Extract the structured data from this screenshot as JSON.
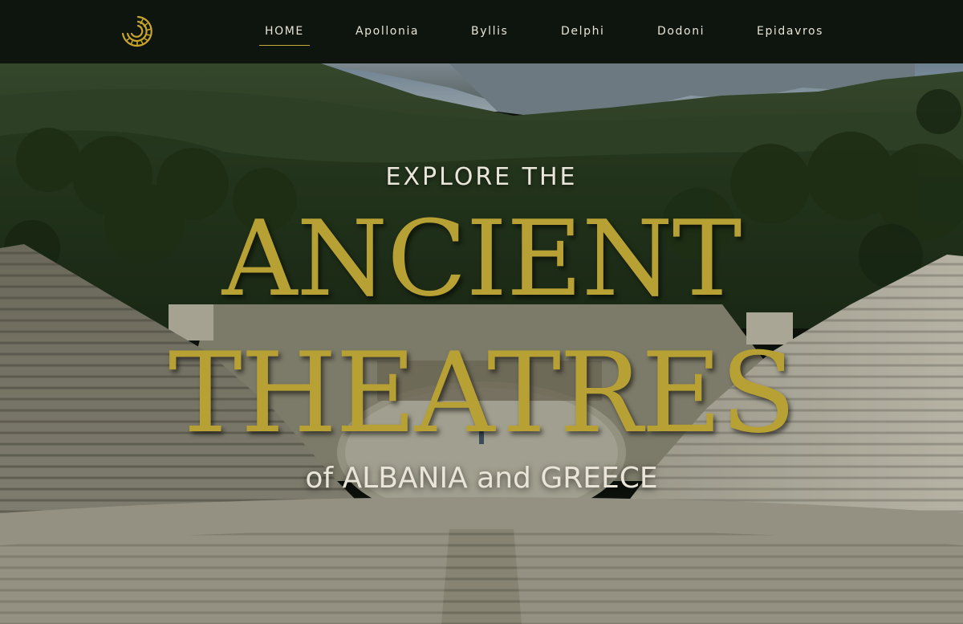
{
  "nav": {
    "logo_icon": "theatre-logo-icon",
    "items": [
      {
        "label": "HOME",
        "active": true
      },
      {
        "label": "Apollonia",
        "active": false
      },
      {
        "label": "Byllis",
        "active": false
      },
      {
        "label": "Delphi",
        "active": false
      },
      {
        "label": "Dodoni",
        "active": false
      },
      {
        "label": "Epidavros",
        "active": false
      }
    ]
  },
  "hero": {
    "kicker": "EXPLORE THE",
    "title_line_1": "ANCIENT",
    "title_line_2": "THEATRES",
    "subtitle": "of ALBANIA and GREECE"
  },
  "colors": {
    "nav_background": "#0e140e",
    "accent_gold": "#b8a134",
    "nav_text": "#e7e4d6"
  }
}
